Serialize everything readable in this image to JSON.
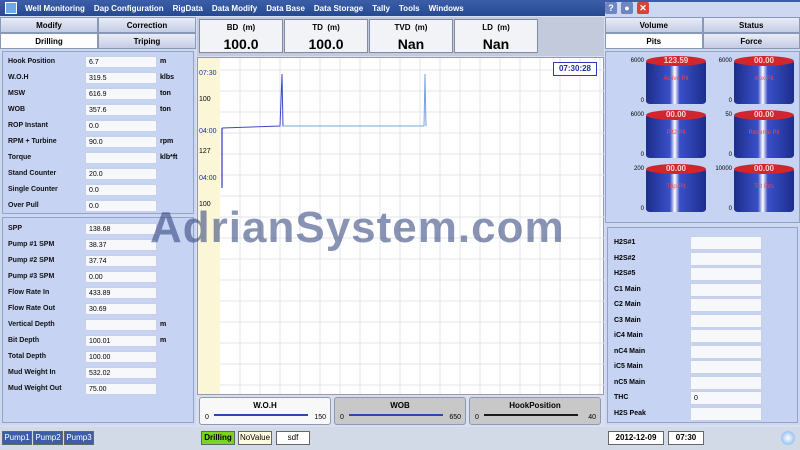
{
  "menu": [
    "Well Monitoring",
    "Dap Configuration",
    "RigData",
    "Data Modify",
    "Data Base",
    "Data Storage",
    "Tally",
    "Tools",
    "Windows"
  ],
  "left": {
    "tabs_top": [
      "Modify",
      "Correction"
    ],
    "tabs_bottom": [
      "Drilling",
      "Triping"
    ],
    "params": [
      {
        "label": "Hook Position",
        "value": "6.7",
        "unit": "m"
      },
      {
        "label": "W.O.H",
        "value": "319.5",
        "unit": "klbs"
      },
      {
        "label": "MSW",
        "value": "616.9",
        "unit": "ton"
      },
      {
        "label": "WOB",
        "value": "357.6",
        "unit": "ton"
      },
      {
        "label": "ROP Instant",
        "value": "0.0",
        "unit": ""
      },
      {
        "label": "RPM + Turbine",
        "value": "90.0",
        "unit": "rpm"
      },
      {
        "label": "Torque",
        "value": "",
        "unit": "klb*ft"
      },
      {
        "label": "Stand Counter",
        "value": "20.0",
        "unit": ""
      },
      {
        "label": "Single Counter",
        "value": "0.0",
        "unit": ""
      },
      {
        "label": "Over Pull",
        "value": "0.0",
        "unit": ""
      }
    ],
    "params2": [
      {
        "label": "SPP",
        "value": "138.68",
        "unit": ""
      },
      {
        "label": "Pump #1 SPM",
        "value": "38.37",
        "unit": ""
      },
      {
        "label": "Pump #2 SPM",
        "value": "37.74",
        "unit": ""
      },
      {
        "label": "Pump #3 SPM",
        "value": "0.00",
        "unit": ""
      },
      {
        "label": "Flow Rate In",
        "value": "433.89",
        "unit": ""
      },
      {
        "label": "Flow Rate Out",
        "value": "30.69",
        "unit": ""
      },
      {
        "label": "Vertical Depth",
        "value": "",
        "unit": "m"
      },
      {
        "label": "Bit Depth",
        "value": "100.01",
        "unit": "m"
      },
      {
        "label": "Total Depth",
        "value": "100.00",
        "unit": ""
      },
      {
        "label": "Mud Weight In",
        "value": "532.02",
        "unit": ""
      },
      {
        "label": "Mud Weight Out",
        "value": "75.00",
        "unit": ""
      }
    ]
  },
  "gauges": [
    {
      "t": "BD",
      "u": "(m)",
      "v": "100.0"
    },
    {
      "t": "TD",
      "u": "(m)",
      "v": "100.0"
    },
    {
      "t": "TVD",
      "u": "(m)",
      "v": "Nan"
    },
    {
      "t": "LD",
      "u": "(m)",
      "v": "Nan"
    }
  ],
  "chart": {
    "clock": "07:30:28",
    "times": [
      "07:30",
      "100",
      "04:00",
      "127",
      "04:00",
      "100"
    ]
  },
  "bottom_gauges": [
    {
      "name": "W.O.H",
      "min": "0",
      "max": "150",
      "color": "#2a4ab0",
      "bg": "#f8f8f8"
    },
    {
      "name": "WOB",
      "min": "0",
      "max": "650",
      "color": "#2a4ab0",
      "bg": "#c8c8c8"
    },
    {
      "name": "HookPosition",
      "min": "0",
      "max": "40",
      "color": "#1a1a1a",
      "bg": "#c8c8c8"
    }
  ],
  "right": {
    "tabs_top": [
      "Volume",
      "Status"
    ],
    "tabs_bottom": [
      "Pits",
      "Force"
    ],
    "tanks": [
      {
        "v": "123.59",
        "n": "Active Pit",
        "s": "6000"
      },
      {
        "v": "00.00",
        "n": "Aux Pit",
        "s": "6000"
      },
      {
        "v": "00.00",
        "n": "Pit2 Pit",
        "s": "6000"
      },
      {
        "v": "00.00",
        "n": "Reserve Pit",
        "s": "50"
      },
      {
        "v": "00.00",
        "n": "Trip Pit",
        "s": "200"
      },
      {
        "v": "00.00",
        "n": "Tot Pits",
        "s": "10000"
      }
    ],
    "tank_low": "0",
    "gas": [
      {
        "label": "H2S#1",
        "value": ""
      },
      {
        "label": "H2S#2",
        "value": ""
      },
      {
        "label": "H2S#5",
        "value": ""
      },
      {
        "label": "C1 Main",
        "value": ""
      },
      {
        "label": "C2 Main",
        "value": ""
      },
      {
        "label": "C3 Main",
        "value": ""
      },
      {
        "label": "iC4 Main",
        "value": ""
      },
      {
        "label": "nC4 Main",
        "value": ""
      },
      {
        "label": "iC5 Main",
        "value": ""
      },
      {
        "label": "nC5 Main",
        "value": ""
      },
      {
        "label": "THC",
        "value": "0"
      },
      {
        "label": "H2S Peak",
        "value": ""
      }
    ]
  },
  "status": {
    "pumps": [
      "Pump1",
      "Pump2",
      "Pump3"
    ],
    "mode": "Drilling",
    "novalue": "NoValue",
    "sdf": "sdf",
    "date": "2012-12-09",
    "time": "07:30"
  },
  "watermark": "AdrianSystem.com"
}
